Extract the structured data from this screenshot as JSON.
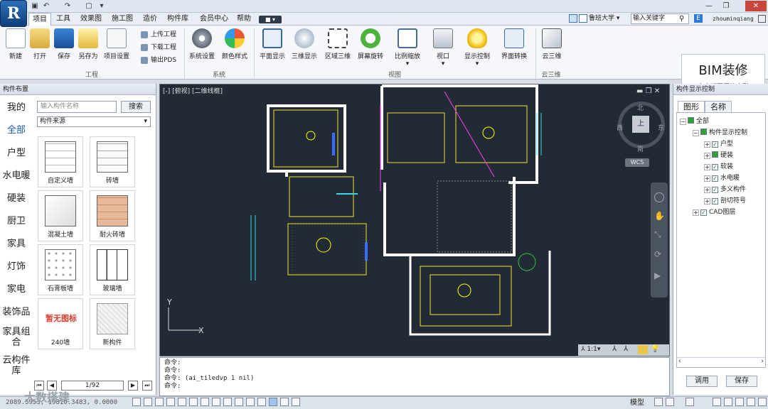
{
  "menu": {
    "items": [
      "项目",
      "工具",
      "效果图",
      "施工图",
      "造价",
      "构件库",
      "会员中心",
      "帮助"
    ],
    "active": "项目"
  },
  "top_right": {
    "school": "鲁班大学",
    "search_placeholder": "输入关键字",
    "user": "zhouminqiang"
  },
  "ribbon": {
    "groups": [
      {
        "label": "工程",
        "buttons": [
          "新建",
          "打开",
          "保存",
          "另存为",
          "项目设置"
        ],
        "small": [
          "上传工程",
          "下载工程",
          "输出PDS"
        ]
      },
      {
        "label": "系统",
        "buttons": [
          "系统设置",
          "颜色样式"
        ]
      },
      {
        "label": "视图",
        "buttons": [
          "平面显示",
          "三维显示",
          "区域三维",
          "屏幕旋转",
          "比例缩放",
          "视口",
          "显示控制",
          "界面转换"
        ]
      },
      {
        "label": "云三维",
        "buttons": [
          "云三维"
        ]
      }
    ],
    "bim": {
      "title": "BIM装修",
      "subtitle": "点击返回原始户型"
    }
  },
  "left_panel": {
    "title": "构件布置",
    "search_placeholder": "输入构件名称",
    "search_button": "搜索",
    "source_select": "构件来源",
    "categories": [
      "我的",
      "全部",
      "户型",
      "水电暖",
      "硬装",
      "厨卫",
      "家具",
      "灯饰",
      "家电",
      "装饰品",
      "家具组合",
      "云构件库"
    ],
    "active_category": "全部",
    "components": [
      "自定义墙",
      "砖墙",
      "混凝土墙",
      "耐火砖墙",
      "石膏板墙",
      "玻璃墙",
      "240墙",
      "新构件"
    ],
    "no_icon_text": "暂无图标",
    "pager": "1/92"
  },
  "viewport": {
    "label": "[-] [俯视] [二维线框]",
    "compass": {
      "n": "北",
      "s": "南",
      "e": "东",
      "w": "西",
      "center": "上"
    },
    "wcs": "WCS",
    "axis_x": "X",
    "axis_y": "Y",
    "scale": "1:1"
  },
  "command": {
    "lines": [
      "命令:",
      "命令:",
      "命令: (ai_tiledvp 1 nil)",
      "命令:"
    ]
  },
  "right_panel": {
    "title": "构件显示控制",
    "tabs": [
      "图形",
      "名称"
    ],
    "tree": [
      {
        "label": "全部",
        "level": 0
      },
      {
        "label": "构件显示控制",
        "level": 1
      },
      {
        "label": "户型",
        "level": 2
      },
      {
        "label": "硬装",
        "level": 2
      },
      {
        "label": "软装",
        "level": 2
      },
      {
        "label": "水电暖",
        "level": 2
      },
      {
        "label": "多义构件",
        "level": 2
      },
      {
        "label": "剖切符号",
        "level": 2
      },
      {
        "label": "CAD图层",
        "level": 1
      }
    ],
    "buttons": [
      "调用",
      "保存"
    ]
  },
  "status": {
    "coords": "2089.5953, 19810.3483, 0.0000",
    "mode": "模型",
    "watermark": "大数搭建"
  }
}
